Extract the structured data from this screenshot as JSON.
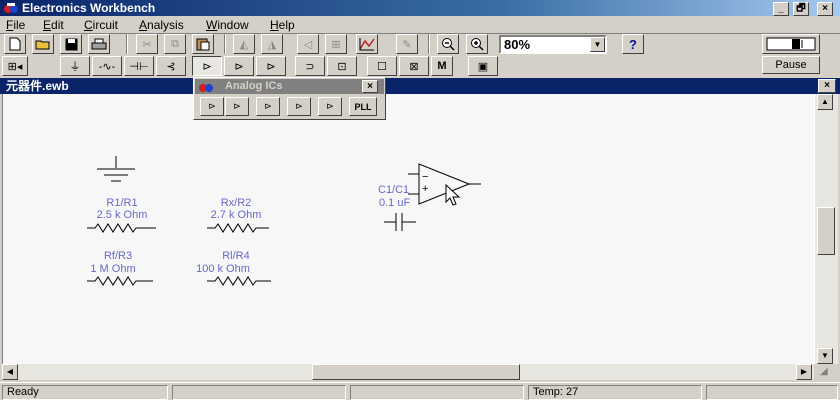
{
  "window": {
    "title": "Electronics Workbench",
    "btn_min": "_",
    "btn_restore": "🗗",
    "btn_close": "×"
  },
  "menu": [
    {
      "label": "File",
      "key": "F"
    },
    {
      "label": "Edit",
      "key": "E"
    },
    {
      "label": "Circuit",
      "key": "C"
    },
    {
      "label": "Analysis",
      "key": "A"
    },
    {
      "label": "Window",
      "key": "W"
    },
    {
      "label": "Help",
      "key": "H"
    }
  ],
  "toolbar": {
    "zoom_value": "80%",
    "help_label": "?",
    "pause_label": "Pause",
    "button_M": "M"
  },
  "document": {
    "title": "元器件.ewb",
    "close_label": "×"
  },
  "palette": {
    "title": "Analog ICs",
    "close_label": "×",
    "pll_label": "PLL"
  },
  "components": {
    "r1": {
      "name": "R1/R1",
      "value": "2.5 k Ohm"
    },
    "r2": {
      "name": "Rx/R2",
      "value": "2.7 k Ohm"
    },
    "r3": {
      "name": "Rf/R3",
      "value": "1 M Ohm"
    },
    "r4": {
      "name": "Rl/R4",
      "value": "100 k Ohm"
    },
    "c1": {
      "name": "C1/C1",
      "value": "0.1 uF"
    },
    "opamp_minus": "−",
    "opamp_plus": "+"
  },
  "status": {
    "ready": "Ready",
    "temp": "Temp:  27"
  },
  "colors": {
    "title_bar": "#0a246a",
    "component_label": "#6868cc"
  }
}
